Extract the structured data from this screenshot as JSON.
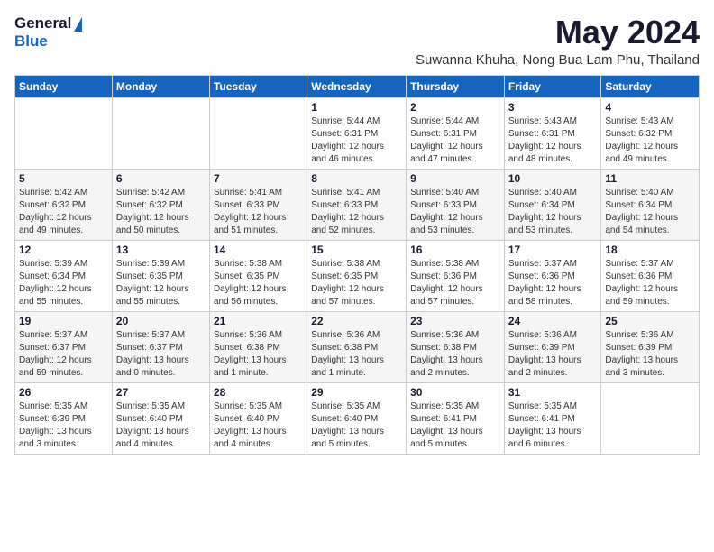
{
  "header": {
    "logo_general": "General",
    "logo_blue": "Blue",
    "month_title": "May 2024",
    "subtitle": "Suwanna Khuha, Nong Bua Lam Phu, Thailand"
  },
  "days_of_week": [
    "Sunday",
    "Monday",
    "Tuesday",
    "Wednesday",
    "Thursday",
    "Friday",
    "Saturday"
  ],
  "weeks": [
    [
      {
        "day": "",
        "info": ""
      },
      {
        "day": "",
        "info": ""
      },
      {
        "day": "",
        "info": ""
      },
      {
        "day": "1",
        "info": "Sunrise: 5:44 AM\nSunset: 6:31 PM\nDaylight: 12 hours\nand 46 minutes."
      },
      {
        "day": "2",
        "info": "Sunrise: 5:44 AM\nSunset: 6:31 PM\nDaylight: 12 hours\nand 47 minutes."
      },
      {
        "day": "3",
        "info": "Sunrise: 5:43 AM\nSunset: 6:31 PM\nDaylight: 12 hours\nand 48 minutes."
      },
      {
        "day": "4",
        "info": "Sunrise: 5:43 AM\nSunset: 6:32 PM\nDaylight: 12 hours\nand 49 minutes."
      }
    ],
    [
      {
        "day": "5",
        "info": "Sunrise: 5:42 AM\nSunset: 6:32 PM\nDaylight: 12 hours\nand 49 minutes."
      },
      {
        "day": "6",
        "info": "Sunrise: 5:42 AM\nSunset: 6:32 PM\nDaylight: 12 hours\nand 50 minutes."
      },
      {
        "day": "7",
        "info": "Sunrise: 5:41 AM\nSunset: 6:33 PM\nDaylight: 12 hours\nand 51 minutes."
      },
      {
        "day": "8",
        "info": "Sunrise: 5:41 AM\nSunset: 6:33 PM\nDaylight: 12 hours\nand 52 minutes."
      },
      {
        "day": "9",
        "info": "Sunrise: 5:40 AM\nSunset: 6:33 PM\nDaylight: 12 hours\nand 53 minutes."
      },
      {
        "day": "10",
        "info": "Sunrise: 5:40 AM\nSunset: 6:34 PM\nDaylight: 12 hours\nand 53 minutes."
      },
      {
        "day": "11",
        "info": "Sunrise: 5:40 AM\nSunset: 6:34 PM\nDaylight: 12 hours\nand 54 minutes."
      }
    ],
    [
      {
        "day": "12",
        "info": "Sunrise: 5:39 AM\nSunset: 6:34 PM\nDaylight: 12 hours\nand 55 minutes."
      },
      {
        "day": "13",
        "info": "Sunrise: 5:39 AM\nSunset: 6:35 PM\nDaylight: 12 hours\nand 55 minutes."
      },
      {
        "day": "14",
        "info": "Sunrise: 5:38 AM\nSunset: 6:35 PM\nDaylight: 12 hours\nand 56 minutes."
      },
      {
        "day": "15",
        "info": "Sunrise: 5:38 AM\nSunset: 6:35 PM\nDaylight: 12 hours\nand 57 minutes."
      },
      {
        "day": "16",
        "info": "Sunrise: 5:38 AM\nSunset: 6:36 PM\nDaylight: 12 hours\nand 57 minutes."
      },
      {
        "day": "17",
        "info": "Sunrise: 5:37 AM\nSunset: 6:36 PM\nDaylight: 12 hours\nand 58 minutes."
      },
      {
        "day": "18",
        "info": "Sunrise: 5:37 AM\nSunset: 6:36 PM\nDaylight: 12 hours\nand 59 minutes."
      }
    ],
    [
      {
        "day": "19",
        "info": "Sunrise: 5:37 AM\nSunset: 6:37 PM\nDaylight: 12 hours\nand 59 minutes."
      },
      {
        "day": "20",
        "info": "Sunrise: 5:37 AM\nSunset: 6:37 PM\nDaylight: 13 hours\nand 0 minutes."
      },
      {
        "day": "21",
        "info": "Sunrise: 5:36 AM\nSunset: 6:38 PM\nDaylight: 13 hours\nand 1 minute."
      },
      {
        "day": "22",
        "info": "Sunrise: 5:36 AM\nSunset: 6:38 PM\nDaylight: 13 hours\nand 1 minute."
      },
      {
        "day": "23",
        "info": "Sunrise: 5:36 AM\nSunset: 6:38 PM\nDaylight: 13 hours\nand 2 minutes."
      },
      {
        "day": "24",
        "info": "Sunrise: 5:36 AM\nSunset: 6:39 PM\nDaylight: 13 hours\nand 2 minutes."
      },
      {
        "day": "25",
        "info": "Sunrise: 5:36 AM\nSunset: 6:39 PM\nDaylight: 13 hours\nand 3 minutes."
      }
    ],
    [
      {
        "day": "26",
        "info": "Sunrise: 5:35 AM\nSunset: 6:39 PM\nDaylight: 13 hours\nand 3 minutes."
      },
      {
        "day": "27",
        "info": "Sunrise: 5:35 AM\nSunset: 6:40 PM\nDaylight: 13 hours\nand 4 minutes."
      },
      {
        "day": "28",
        "info": "Sunrise: 5:35 AM\nSunset: 6:40 PM\nDaylight: 13 hours\nand 4 minutes."
      },
      {
        "day": "29",
        "info": "Sunrise: 5:35 AM\nSunset: 6:40 PM\nDaylight: 13 hours\nand 5 minutes."
      },
      {
        "day": "30",
        "info": "Sunrise: 5:35 AM\nSunset: 6:41 PM\nDaylight: 13 hours\nand 5 minutes."
      },
      {
        "day": "31",
        "info": "Sunrise: 5:35 AM\nSunset: 6:41 PM\nDaylight: 13 hours\nand 6 minutes."
      },
      {
        "day": "",
        "info": ""
      }
    ]
  ]
}
